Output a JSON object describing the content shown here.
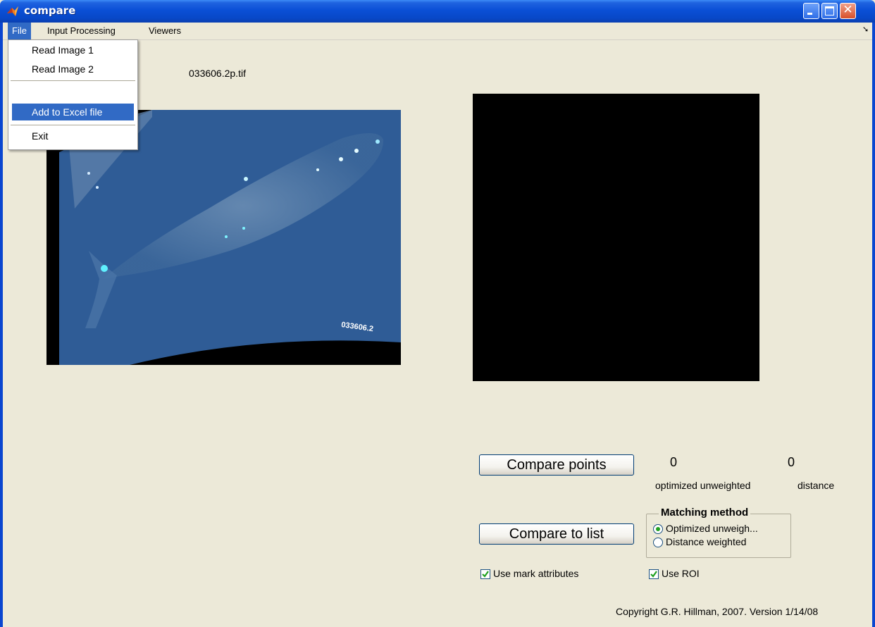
{
  "window": {
    "title": "compare"
  },
  "menubar": {
    "file": "File",
    "input_processing": "Input Processing",
    "viewers": "Viewers"
  },
  "file_menu": {
    "items": [
      "Read Image 1",
      "Read Image 2",
      "Add to Excel file",
      "Exit"
    ],
    "highlighted": "Add to Excel file"
  },
  "image1": {
    "filename": "033606.2p.tif",
    "overlay_label": "033606.2"
  },
  "controls": {
    "compare_points_label": "Compare points",
    "compare_list_label": "Compare to list",
    "value_optimized": "0",
    "value_distance": "0",
    "label_optimized": "optimized unweighted",
    "label_distance": "distance"
  },
  "matching_method": {
    "title": "Matching method",
    "options": [
      "Optimized unweigh...",
      "Distance weighted"
    ],
    "selected": "Optimized unweigh..."
  },
  "checkboxes": {
    "use_mark_attributes": "Use mark attributes",
    "use_roi": "Use ROI",
    "use_mark_attributes_checked": true,
    "use_roi_checked": true
  },
  "footer": {
    "copyright": "Copyright G.R. Hillman, 2007. Version 1/14/08"
  },
  "colors": {
    "title_blue": "#0a4fd6",
    "menu_highlight": "#316ac5",
    "window_bg": "#ece9d8",
    "ocean": "#2d5b95"
  }
}
